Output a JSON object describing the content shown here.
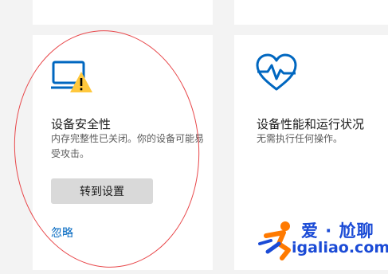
{
  "security_card": {
    "title": "设备安全性",
    "description": "内存完整性已关闭。你的设备可能易受攻击。",
    "button_label": "转到设置",
    "dismiss_link": "忽略"
  },
  "health_card": {
    "title": "设备性能和运行状况",
    "description": "无需执行任何操作。"
  },
  "watermark": {
    "top": "爱 · 尬聊",
    "bottom": "igaliao.com"
  },
  "icons": {
    "security": "laptop-warning-icon",
    "health": "heart-pulse-icon",
    "watermark": "runner-logo-icon"
  },
  "colors": {
    "accent": "#0067c0",
    "warning": "#ffc83d",
    "annotation": "#e8474a",
    "watermark": "#1b4bd6"
  }
}
